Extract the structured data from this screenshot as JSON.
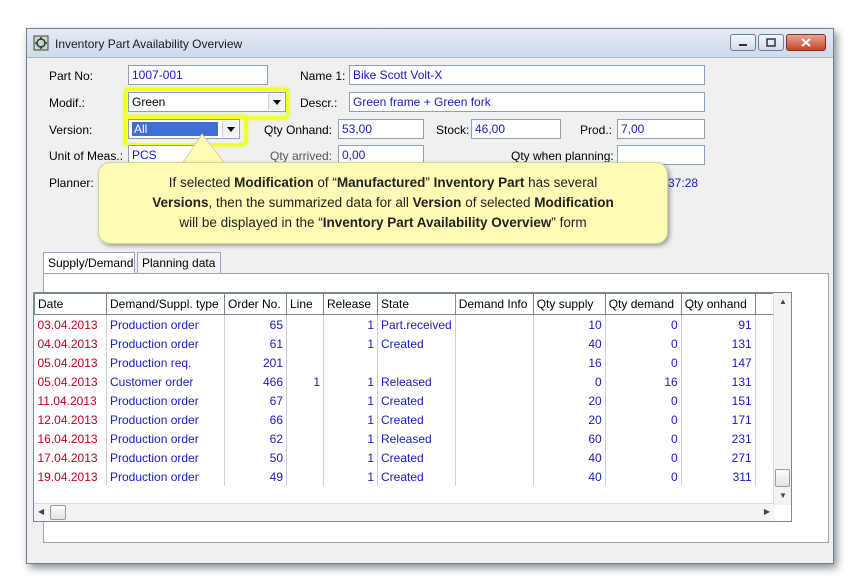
{
  "window": {
    "title": "Inventory Part Availability Overview",
    "icon": "inventory-app-icon"
  },
  "form": {
    "part_no_label": "Part No:",
    "part_no": "1007-001",
    "name1_label": "Name 1:",
    "name1": "Bike Scott Volt-X",
    "modif_label": "Modif.:",
    "modif": "Green",
    "descr_label": "Descr.:",
    "descr": "Green frame + Green fork",
    "version_label": "Version:",
    "version": "All",
    "qty_onhand_label": "Qty Onhand:",
    "qty_onhand": "53,00",
    "stock_label": "Stock:",
    "stock": "46,00",
    "prod_label": "Prod.:",
    "prod": "7,00",
    "uom_label": "Unit of Meas.:",
    "uom": "PCS",
    "qty_arrived_label": "Qty arrived:",
    "qty_arrived": "0,00",
    "qty_planning_label": "Qty when planning:",
    "qty_planning": "",
    "planner_label": "Planner:",
    "planner_time_fragment": "0:37:28"
  },
  "callout": {
    "line1": [
      "If selected ",
      "Modification",
      " of “",
      "Manufactured",
      "” ",
      "Inventory Part",
      " has several"
    ],
    "line2": [
      "Versions",
      ", then the summarized data for all ",
      "Version",
      " of selected ",
      "Modification"
    ],
    "line3": [
      "will be displayed in the “",
      "Inventory Part Availability Overview",
      "” form"
    ]
  },
  "tabs": [
    "Supply/Demand",
    "Planning data"
  ],
  "table": {
    "columns": [
      "Date",
      "Demand/Suppl. type",
      "Order No.",
      "Line",
      "Release",
      "State",
      "Demand Info",
      "Qty supply",
      "Qty demand",
      "Qty onhand"
    ],
    "rows": [
      [
        "03.04.2013",
        "Production order",
        "65",
        "",
        "1",
        "Part.received",
        "",
        "10",
        "0",
        "91"
      ],
      [
        "04.04.2013",
        "Production order",
        "61",
        "",
        "1",
        "Created",
        "",
        "40",
        "0",
        "131"
      ],
      [
        "05.04.2013",
        "Production req.",
        "201",
        "",
        "",
        "",
        "",
        "16",
        "0",
        "147"
      ],
      [
        "05.04.2013",
        "Customer order",
        "466",
        "1",
        "1",
        "Released",
        "",
        "0",
        "16",
        "131"
      ],
      [
        "11.04.2013",
        "Production order",
        "67",
        "",
        "1",
        "Created",
        "",
        "20",
        "0",
        "151"
      ],
      [
        "12.04.2013",
        "Production order",
        "66",
        "",
        "1",
        "Created",
        "",
        "20",
        "0",
        "171"
      ],
      [
        "16.04.2013",
        "Production order",
        "62",
        "",
        "1",
        "Released",
        "",
        "60",
        "0",
        "231"
      ],
      [
        "17.04.2013",
        "Production order",
        "50",
        "",
        "1",
        "Created",
        "",
        "40",
        "0",
        "271"
      ],
      [
        "19.04.2013",
        "Production order",
        "49",
        "",
        "1",
        "Created",
        "",
        "40",
        "0",
        "311"
      ]
    ]
  },
  "colors": {
    "value_text": "#1a1abf",
    "date_text": "#c2001f",
    "highlight": "#f2ff2e",
    "callout_bg": "#fdfbb5",
    "selection": "#3d6fd6"
  }
}
